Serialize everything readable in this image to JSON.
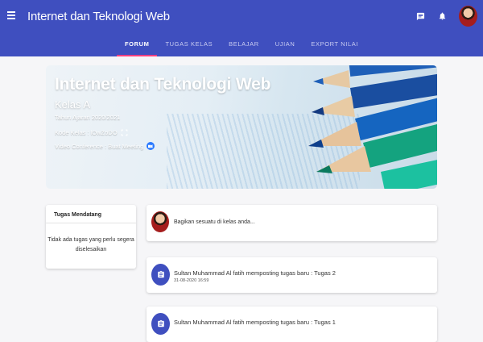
{
  "header": {
    "title": "Internet dan Teknologi Web",
    "icons": [
      "menu-icon",
      "chat-icon",
      "bell-icon",
      "avatar"
    ],
    "color": "#3f4fbf",
    "accent": "#ff4081"
  },
  "tabs": [
    {
      "label": "FORUM",
      "active": true
    },
    {
      "label": "TUGAS KELAS",
      "active": false
    },
    {
      "label": "BELAJAR",
      "active": false
    },
    {
      "label": "UJIAN",
      "active": false
    },
    {
      "label": "EXPORT NILAI",
      "active": false
    }
  ],
  "banner": {
    "title": "Internet dan Teknologi Web",
    "class_name": "Kelas A",
    "year": "Tahun Ajaran 2020/2021",
    "code": "Kode Kelas : lOwZoDO",
    "video": "Video Conference : Buat Meeting"
  },
  "upcoming": {
    "heading": "Tugas Mendatang",
    "message": "Tidak ada tugas yang perlu segera diselesaikan"
  },
  "share": {
    "placeholder": "Bagikan sesuatu di kelas anda..."
  },
  "posts": [
    {
      "title": "Sultan Muhammad Al fatih memposting tugas baru : Tugas 2",
      "date": "31-08-2020 16:59"
    },
    {
      "title": "Sultan Muhammad Al fatih memposting tugas baru : Tugas 1",
      "date": ""
    }
  ]
}
